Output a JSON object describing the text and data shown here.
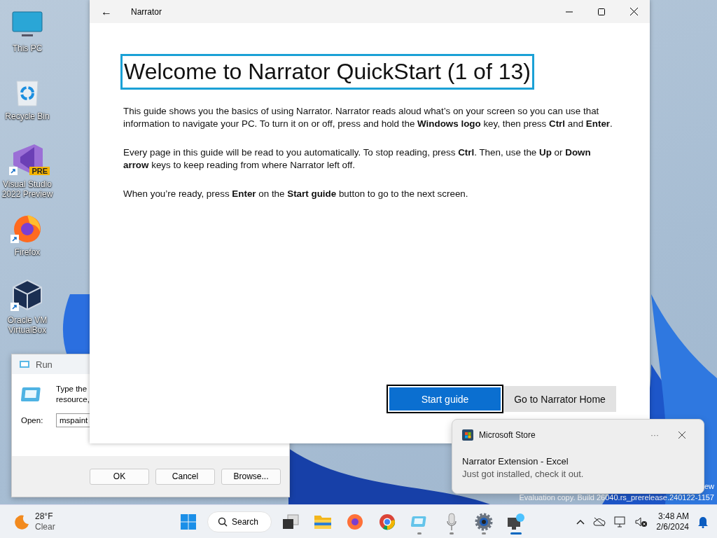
{
  "desktop_icons": [
    {
      "kind": "monitor",
      "label": "This PC",
      "shortcut": false
    },
    {
      "kind": "recycle",
      "label": "Recycle Bin",
      "shortcut": false
    },
    {
      "kind": "studio",
      "label": "Visual Studio 2022 Preview",
      "badge": "PRE",
      "shortcut": true
    },
    {
      "kind": "firefox",
      "label": "Firefox",
      "shortcut": true
    },
    {
      "kind": "cube",
      "label": "Oracle VM VirtualBox",
      "shortcut": true
    }
  ],
  "watermark": {
    "line_1": "ew",
    "line_2": "Evaluation copy. Build 26040.rs_prerelease.240122-1157"
  },
  "run_dialog": {
    "title": "Run",
    "description_line_1": "Type the",
    "description_line_2": "resource,",
    "open_label": "Open:",
    "open_value": "mspaint",
    "buttons": [
      "OK",
      "Cancel",
      "Browse..."
    ]
  },
  "narrator_window": {
    "back": "←",
    "title": "Narrator",
    "heading": "Welcome to Narrator QuickStart (1 of 13)",
    "paragraphs": [
      "This guide shows you the basics of using Narrator. Narrator reads aloud what’s on your screen so you can use that information to navigate your PC. To turn it on or off, press and hold the **Windows logo** key, then press **Ctrl** and **Enter**.",
      "Every page in this guide will be read to you automatically. To stop reading, press **Ctrl**. Then, use the **Up** or **Down arrow** keys to keep reading from where Narrator left off.",
      "When you’re ready, press **Enter** on the **Start guide** button to go to the next screen."
    ],
    "buttons": [
      {
        "label": "Start guide",
        "selected": true
      },
      {
        "label": "Go to Narrator Home",
        "selected": false
      }
    ]
  },
  "notification": {
    "app": "Microsoft Store",
    "more": "···",
    "title": "Narrator Extension - Excel",
    "body": "Just got installed, check it out."
  },
  "taskbar": {
    "weather": {
      "temperature": "28°F",
      "condition": "Clear"
    },
    "search": "Search",
    "apps": [
      {
        "kind": "taskview",
        "running": false,
        "active": false
      },
      {
        "kind": "folder",
        "running": false,
        "active": false
      },
      {
        "kind": "firefox",
        "running": false,
        "active": false
      },
      {
        "kind": "chrome",
        "running": false,
        "active": false
      },
      {
        "kind": "tablet",
        "running": true,
        "active": false
      },
      {
        "kind": "microphone",
        "running": true,
        "active": false
      },
      {
        "kind": "gear",
        "running": true,
        "active": false
      },
      {
        "kind": "narrator",
        "running": true,
        "active": true
      }
    ],
    "time": "3:48 AM",
    "date": "2/6/2024"
  }
}
